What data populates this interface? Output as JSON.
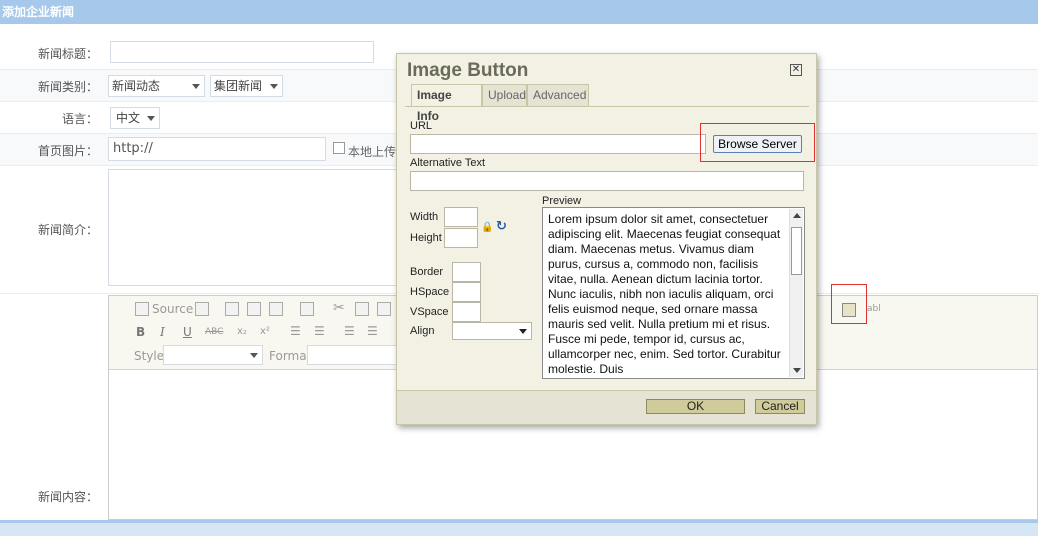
{
  "page": {
    "title": "添加企业新闻"
  },
  "form": {
    "title_label": "新闻标题：",
    "category_label": "新闻类别：",
    "category_select1": "新闻动态",
    "category_select2": "集团新闻",
    "language_label": "语言：",
    "language_select": "中文",
    "image_label": "首页图片：",
    "image_value": "http://",
    "local_upload_label": "本地上传",
    "summary_label": "新闻简介：",
    "content_label": "新闻内容："
  },
  "editor": {
    "source_label": "Source",
    "style_label": "Style",
    "format_label": "Format"
  },
  "dialog": {
    "title": "Image Button",
    "close_glyph": "✕",
    "tabs": [
      {
        "label": "Image Info"
      },
      {
        "label": "Upload"
      },
      {
        "label": "Advanced"
      }
    ],
    "url_label": "URL",
    "browse_button": "Browse Server",
    "alt_label": "Alternative Text",
    "width_label": "Width",
    "height_label": "Height",
    "border_label": "Border",
    "hspace_label": "HSpace",
    "vspace_label": "VSpace",
    "align_label": "Align",
    "preview_label": "Preview",
    "preview_text": "Lorem ipsum dolor sit amet, consectetuer adipiscing elit. Maecenas feugiat consequat diam. Maecenas metus. Vivamus diam purus, cursus a, commodo non, facilisis vitae, nulla. Aenean dictum lacinia tortor. Nunc iaculis, nibh non iaculis aliquam, orci felis euismod neque, sed ornare massa mauris sed velit. Nulla pretium mi et risus. Fusce mi pede, tempor id, cursus ac, ullamcorper nec, enim. Sed tortor. Curabitur molestie. Duis",
    "ok_button": "OK",
    "cancel_button": "Cancel"
  }
}
